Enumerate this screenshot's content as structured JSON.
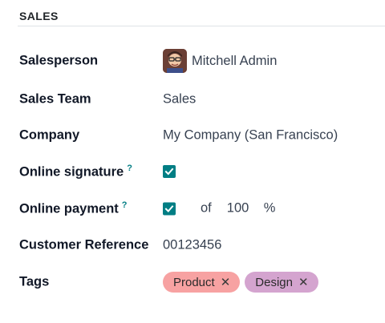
{
  "section": {
    "title": "SALES"
  },
  "fields": {
    "salesperson": {
      "label": "Salesperson",
      "value": "Mitchell Admin"
    },
    "sales_team": {
      "label": "Sales Team",
      "value": "Sales"
    },
    "company": {
      "label": "Company",
      "value": "My Company (San Francisco)"
    },
    "online_signature": {
      "label": "Online signature",
      "help": "?",
      "checked": true
    },
    "online_payment": {
      "label": "Online payment",
      "help": "?",
      "checked": true,
      "of_label": "of",
      "percent": "100",
      "percent_sign": "%"
    },
    "customer_reference": {
      "label": "Customer Reference",
      "value": "00123456"
    },
    "tags": {
      "label": "Tags",
      "items": [
        {
          "label": "Product",
          "color": "#f7a2a2",
          "close": "✕"
        },
        {
          "label": "Design",
          "color": "#d4a4cf",
          "close": "✕"
        }
      ]
    }
  },
  "colors": {
    "accent": "#017e84"
  }
}
